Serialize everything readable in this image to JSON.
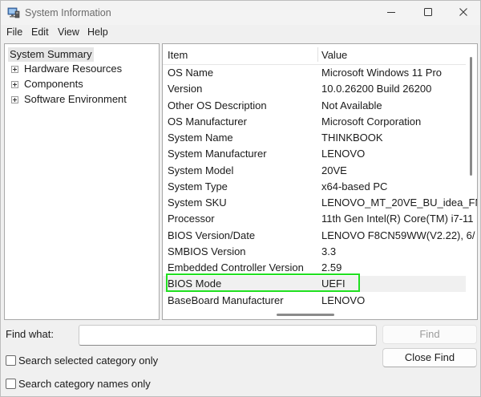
{
  "window": {
    "title": "System Information"
  },
  "menu": [
    "File",
    "Edit",
    "View",
    "Help"
  ],
  "tree": {
    "root": "System Summary",
    "children": [
      "Hardware Resources",
      "Components",
      "Software Environment"
    ]
  },
  "table": {
    "headers": [
      "Item",
      "Value"
    ],
    "rows": [
      [
        "OS Name",
        "Microsoft Windows 11 Pro"
      ],
      [
        "Version",
        "10.0.26200 Build 26200"
      ],
      [
        "Other OS Description",
        "Not Available"
      ],
      [
        "OS Manufacturer",
        "Microsoft Corporation"
      ],
      [
        "System Name",
        "THINKBOOK"
      ],
      [
        "System Manufacturer",
        "LENOVO"
      ],
      [
        "System Model",
        "20VE"
      ],
      [
        "System Type",
        "x64-based PC"
      ],
      [
        "System SKU",
        "LENOVO_MT_20VE_BU_idea_FM_"
      ],
      [
        "Processor",
        "11th Gen Intel(R) Core(TM) i7-11"
      ],
      [
        "BIOS Version/Date",
        "LENOVO F8CN59WW(V2.22), 6/"
      ],
      [
        "SMBIOS Version",
        "3.3"
      ],
      [
        "Embedded Controller Version",
        "2.59"
      ],
      [
        "BIOS Mode",
        "UEFI"
      ],
      [
        "BaseBoard Manufacturer",
        "LENOVO"
      ]
    ],
    "highlighted_row_index": 13
  },
  "find": {
    "label": "Find what:",
    "value": "",
    "find_button": "Find",
    "close_button": "Close Find",
    "search_selected_label": "Search selected category only",
    "search_names_label": "Search category names only"
  },
  "colors": {
    "highlight_box": "#20e020"
  }
}
